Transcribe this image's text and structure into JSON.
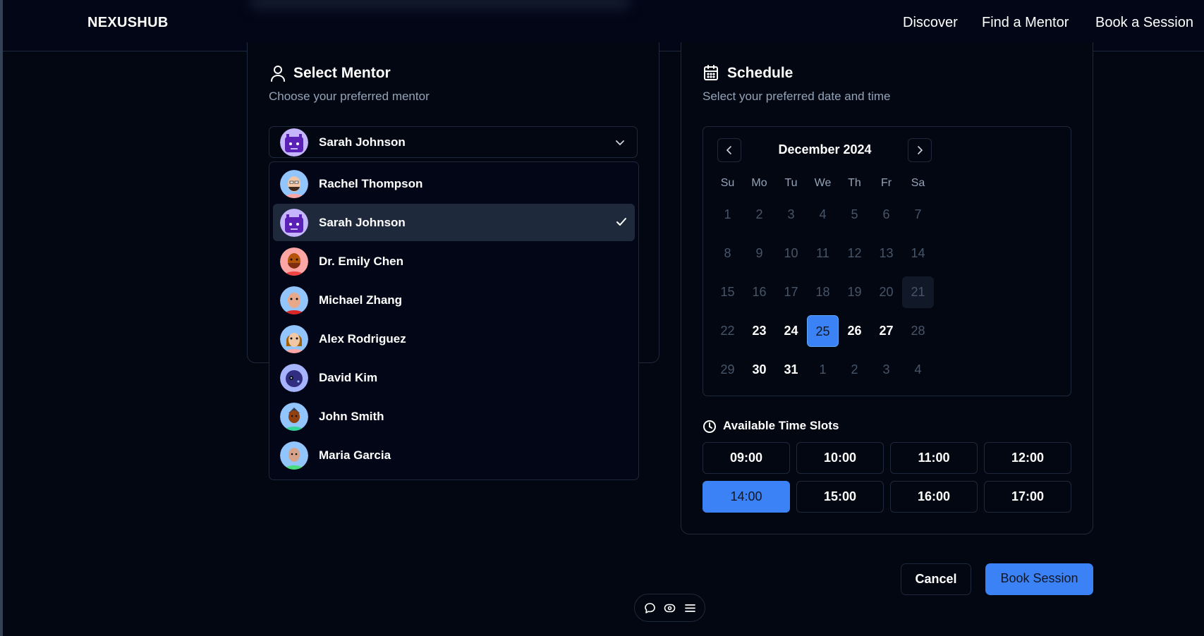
{
  "header": {
    "logo": "NEXUSHUB",
    "nav": [
      "Discover",
      "Find a Mentor",
      "Book a Session"
    ]
  },
  "mentor": {
    "title": "Select Mentor",
    "subtitle": "Choose your preferred mentor",
    "selected": "Sarah Johnson",
    "options": [
      "Rachel Thompson",
      "Sarah Johnson",
      "Dr. Emily Chen",
      "Michael Zhang",
      "Alex Rodriguez",
      "David Kim",
      "John Smith",
      "Maria Garcia"
    ],
    "selected_index": 1
  },
  "schedule": {
    "title": "Schedule",
    "subtitle": "Select your preferred date and time",
    "month": "December 2024",
    "weekdays": [
      "Su",
      "Mo",
      "Tu",
      "We",
      "Th",
      "Fr",
      "Sa"
    ],
    "weeks": [
      [
        "1",
        "2",
        "3",
        "4",
        "5",
        "6",
        "7"
      ],
      [
        "8",
        "9",
        "10",
        "11",
        "12",
        "13",
        "14"
      ],
      [
        "15",
        "16",
        "17",
        "18",
        "19",
        "20",
        "21"
      ],
      [
        "22",
        "23",
        "24",
        "25",
        "26",
        "27",
        "28"
      ],
      [
        "29",
        "30",
        "31",
        "1",
        "2",
        "3",
        "4"
      ]
    ],
    "available_days": [
      "23",
      "24",
      "25",
      "26",
      "27",
      "30",
      "31"
    ],
    "today": "21",
    "selected_day": "25",
    "slots_title": "Available Time Slots",
    "slots": [
      "09:00",
      "10:00",
      "11:00",
      "12:00",
      "14:00",
      "15:00",
      "16:00",
      "17:00"
    ],
    "selected_slot": "14:00"
  },
  "actions": {
    "cancel": "Cancel",
    "book": "Book Session"
  },
  "colors": {
    "accent": "#3b82f6",
    "background": "#030712",
    "border": "#1e293b"
  }
}
